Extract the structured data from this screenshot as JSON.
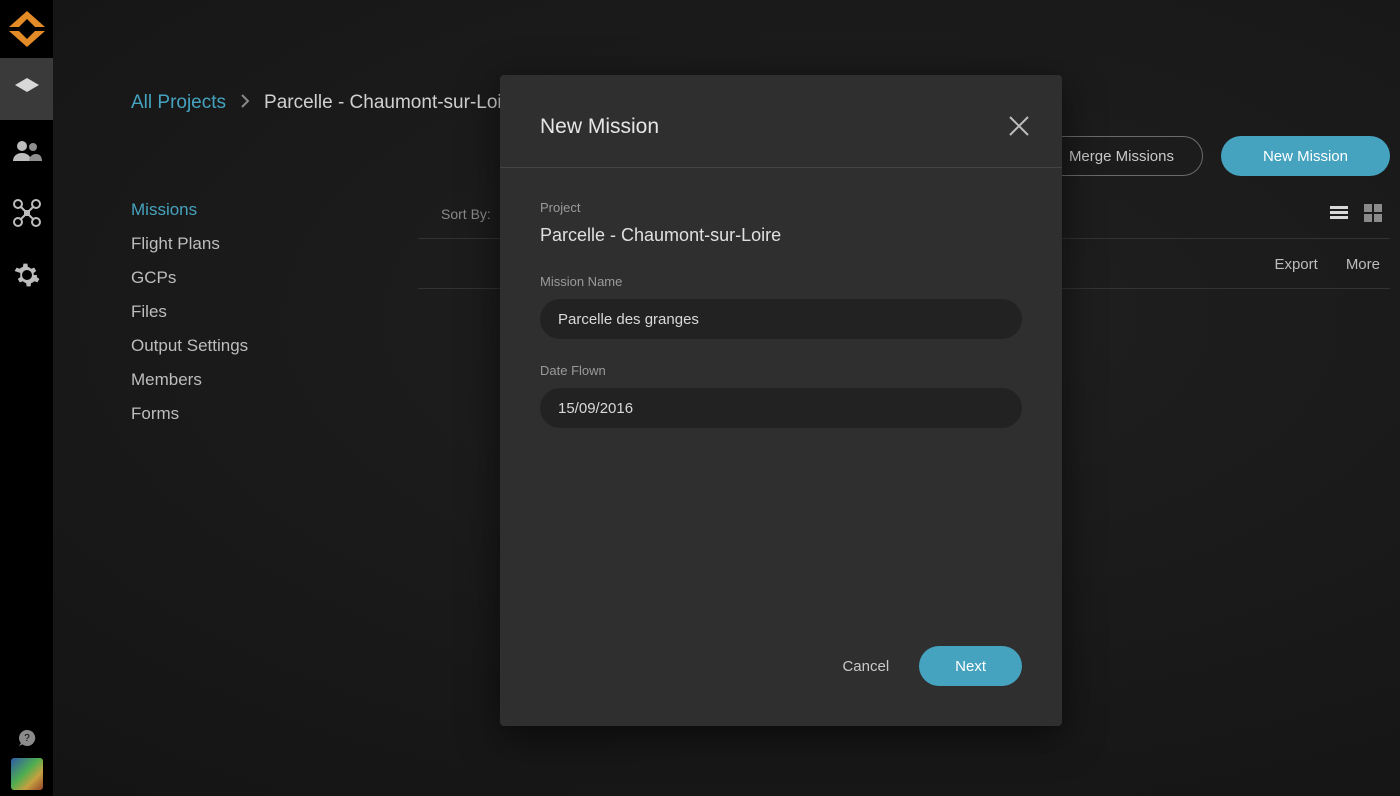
{
  "colors": {
    "accent": "#45a3bf",
    "brand": "#e38b27"
  },
  "rail": {
    "items": [
      "logo",
      "layers",
      "users",
      "drone",
      "settings"
    ],
    "active_index": 1
  },
  "breadcrumb": {
    "root": "All Projects",
    "current": "Parcelle - Chaumont-sur-Loire"
  },
  "actions": {
    "merge": "Merge Missions",
    "new_mission": "New Mission"
  },
  "side_nav": {
    "items": [
      "Missions",
      "Flight Plans",
      "GCPs",
      "Files",
      "Output Settings",
      "Members",
      "Forms"
    ],
    "active_index": 0
  },
  "list": {
    "sort_by_label": "Sort By:",
    "row_actions": {
      "export": "Export",
      "more": "More"
    }
  },
  "modal": {
    "title": "New Mission",
    "project_label": "Project",
    "project_value": "Parcelle - Chaumont-sur-Loire",
    "name_label": "Mission Name",
    "name_value": "Parcelle des granges",
    "date_label": "Date Flown",
    "date_value": "15/09/2016",
    "cancel": "Cancel",
    "next": "Next"
  }
}
